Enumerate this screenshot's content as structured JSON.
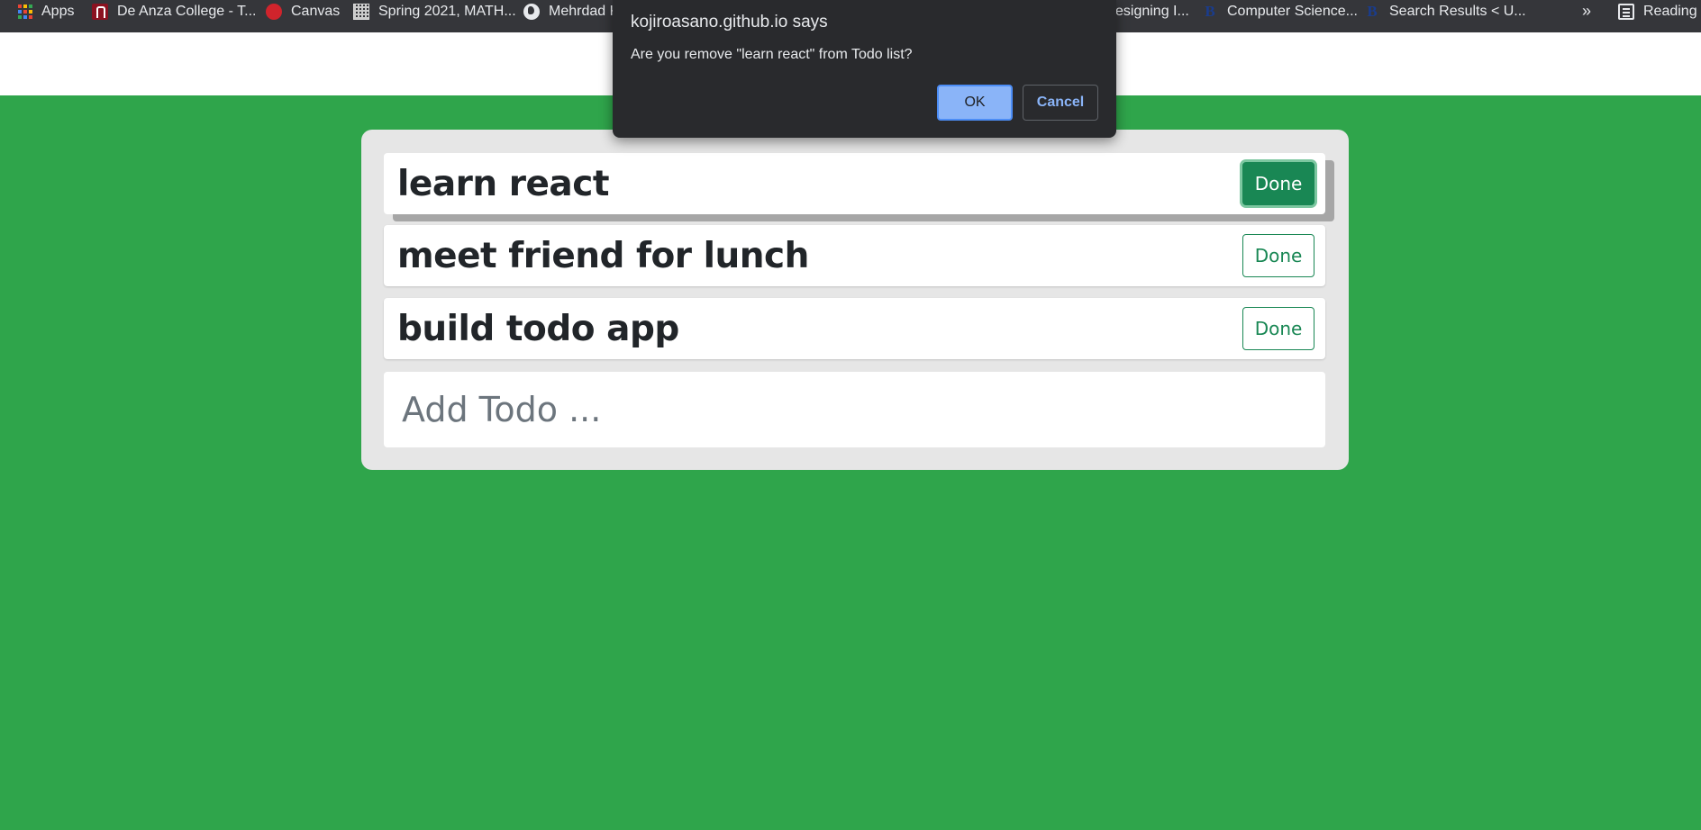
{
  "bookmarks_bar": {
    "items": [
      {
        "label": "Apps",
        "icon": "apps-grid-icon"
      },
      {
        "label": "De Anza College - T...",
        "icon": "de-anza-icon"
      },
      {
        "label": "Canvas",
        "icon": "canvas-icon"
      },
      {
        "label": "Spring 2021, MATH...",
        "icon": "grid-icon"
      },
      {
        "label": "Mehrdad K",
        "icon": "globe-icon"
      },
      {
        "label": "esigning I...",
        "icon": ""
      },
      {
        "label": "Computer Science...",
        "icon": "b-icon"
      },
      {
        "label": "Search Results < U...",
        "icon": "b-icon"
      },
      {
        "label": "Reading l",
        "icon": "reading-list-icon"
      }
    ],
    "overflow": "»"
  },
  "dialog": {
    "title": "kojiroasano.github.io says",
    "message": "Are you remove \"learn react\" from Todo list?",
    "ok_label": "OK",
    "cancel_label": "Cancel"
  },
  "todos": [
    {
      "text": "learn react",
      "button": "Done",
      "state": "pressed"
    },
    {
      "text": "meet friend for lunch",
      "button": "Done",
      "state": "normal"
    },
    {
      "text": "build todo app",
      "button": "Done",
      "state": "normal"
    }
  ],
  "add_todo": {
    "placeholder": "Add Todo ...",
    "value": ""
  },
  "colors": {
    "page_background": "#2fa54b",
    "card_background": "#e6e6e6",
    "done_button": "#198754",
    "dialog_background": "#292a2d",
    "dialog_ok": "#8ab4f8"
  }
}
